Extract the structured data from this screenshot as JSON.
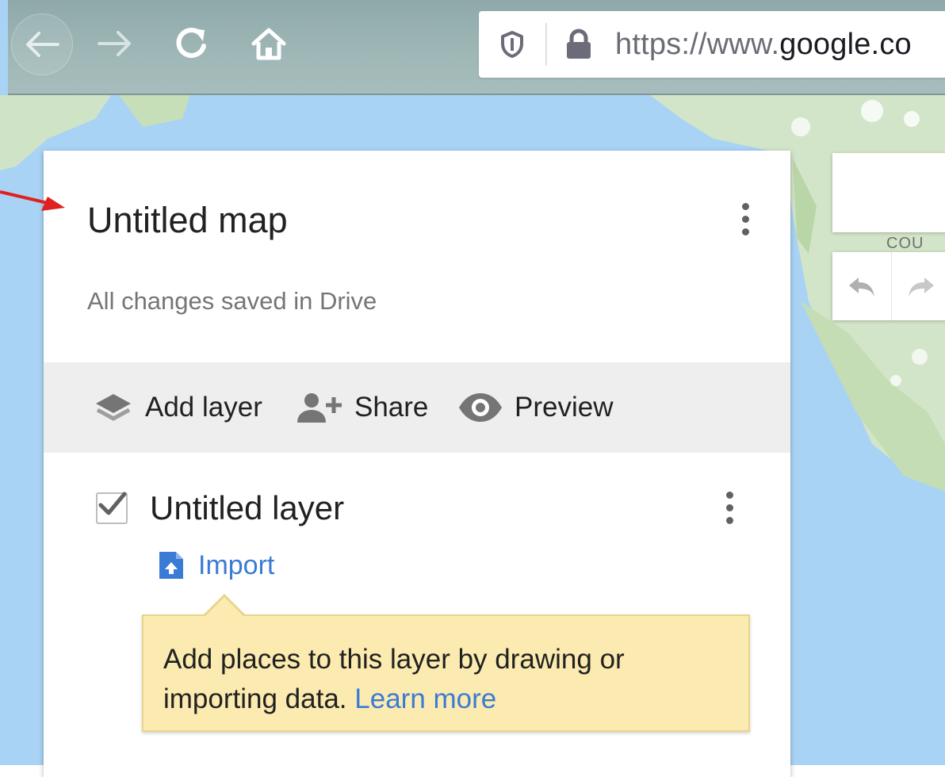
{
  "browser": {
    "url_prefix": "https://www.",
    "url_host": "google.co",
    "icons": [
      "back-icon",
      "forward-icon",
      "reload-icon",
      "home-icon",
      "tracking-shield-icon",
      "lock-icon"
    ]
  },
  "map_controls": {
    "place_label": "COU",
    "icons": [
      "undo-icon",
      "redo-icon"
    ]
  },
  "panel": {
    "title": "Untitled map",
    "save_status": "All changes saved in Drive",
    "toolbar": {
      "add_layer": "Add layer",
      "share": "Share",
      "preview": "Preview"
    },
    "layer": {
      "name": "Untitled layer",
      "checked": true,
      "import_label": "Import"
    },
    "tip": {
      "text_line1": "Add places to this layer by drawing or",
      "text_line2": "importing data.",
      "learn_more": "Learn more"
    }
  },
  "colors": {
    "accent_link": "#3a7bd5",
    "tip_background": "#fcebb0",
    "toolbar_background": "#eeeeee",
    "annotation_arrow": "#e02020",
    "water": "#a9d3f5"
  }
}
